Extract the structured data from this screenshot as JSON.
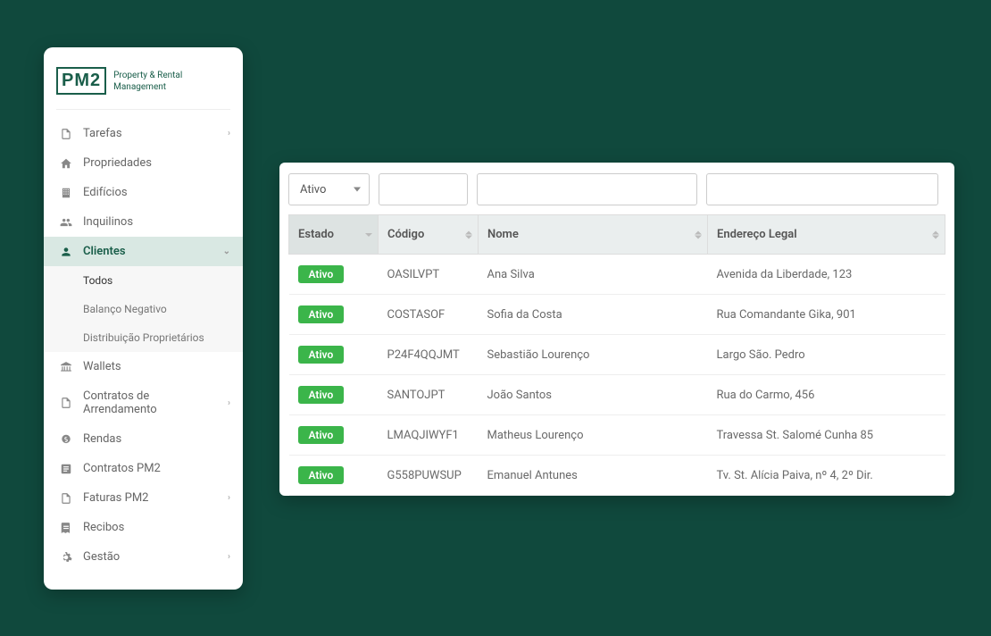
{
  "logo": {
    "text": "PM2",
    "tagline_l1": "Property & Rental",
    "tagline_l2": "Management"
  },
  "nav": {
    "tarefas": "Tarefas",
    "propriedades": "Propriedades",
    "edificios": "Edifícios",
    "inquilinos": "Inquilinos",
    "clientes": "Clientes",
    "wallets": "Wallets",
    "contratos_arr": "Contratos de Arrendamento",
    "rendas": "Rendas",
    "contratos_pm2": "Contratos PM2",
    "faturas_pm2": "Faturas PM2",
    "recibos": "Recibos",
    "gestao": "Gestão"
  },
  "subnav": {
    "todos": "Todos",
    "balanco": "Balanço Negativo",
    "distrib": "Distribuição Proprietários"
  },
  "filters": {
    "estado_selected": "Ativo"
  },
  "headers": {
    "estado": "Estado",
    "codigo": "Código",
    "nome": "Nome",
    "endereco": "Endereço Legal"
  },
  "rows": [
    {
      "estado": "Ativo",
      "codigo": "OASILVPT",
      "nome": "Ana Silva",
      "endereco": "Avenida da Liberdade, 123"
    },
    {
      "estado": "Ativo",
      "codigo": "COSTASOF",
      "nome": "Sofia da Costa",
      "endereco": "Rua Comandante Gika, 901"
    },
    {
      "estado": "Ativo",
      "codigo": "P24F4QQJMT",
      "nome": "Sebastião Lourenço",
      "endereco": "Largo São. Pedro"
    },
    {
      "estado": "Ativo",
      "codigo": "SANTOJPT",
      "nome": "João Santos",
      "endereco": "Rua do Carmo, 456"
    },
    {
      "estado": "Ativo",
      "codigo": "LMAQJIWYF1",
      "nome": "Matheus Lourenço",
      "endereco": "Travessa St. Salomé Cunha 85"
    },
    {
      "estado": "Ativo",
      "codigo": "G558PUWSUP",
      "nome": "Emanuel Antunes",
      "endereco": "Tv. St. Alícia Paiva, nº 4, 2º Dir."
    }
  ]
}
